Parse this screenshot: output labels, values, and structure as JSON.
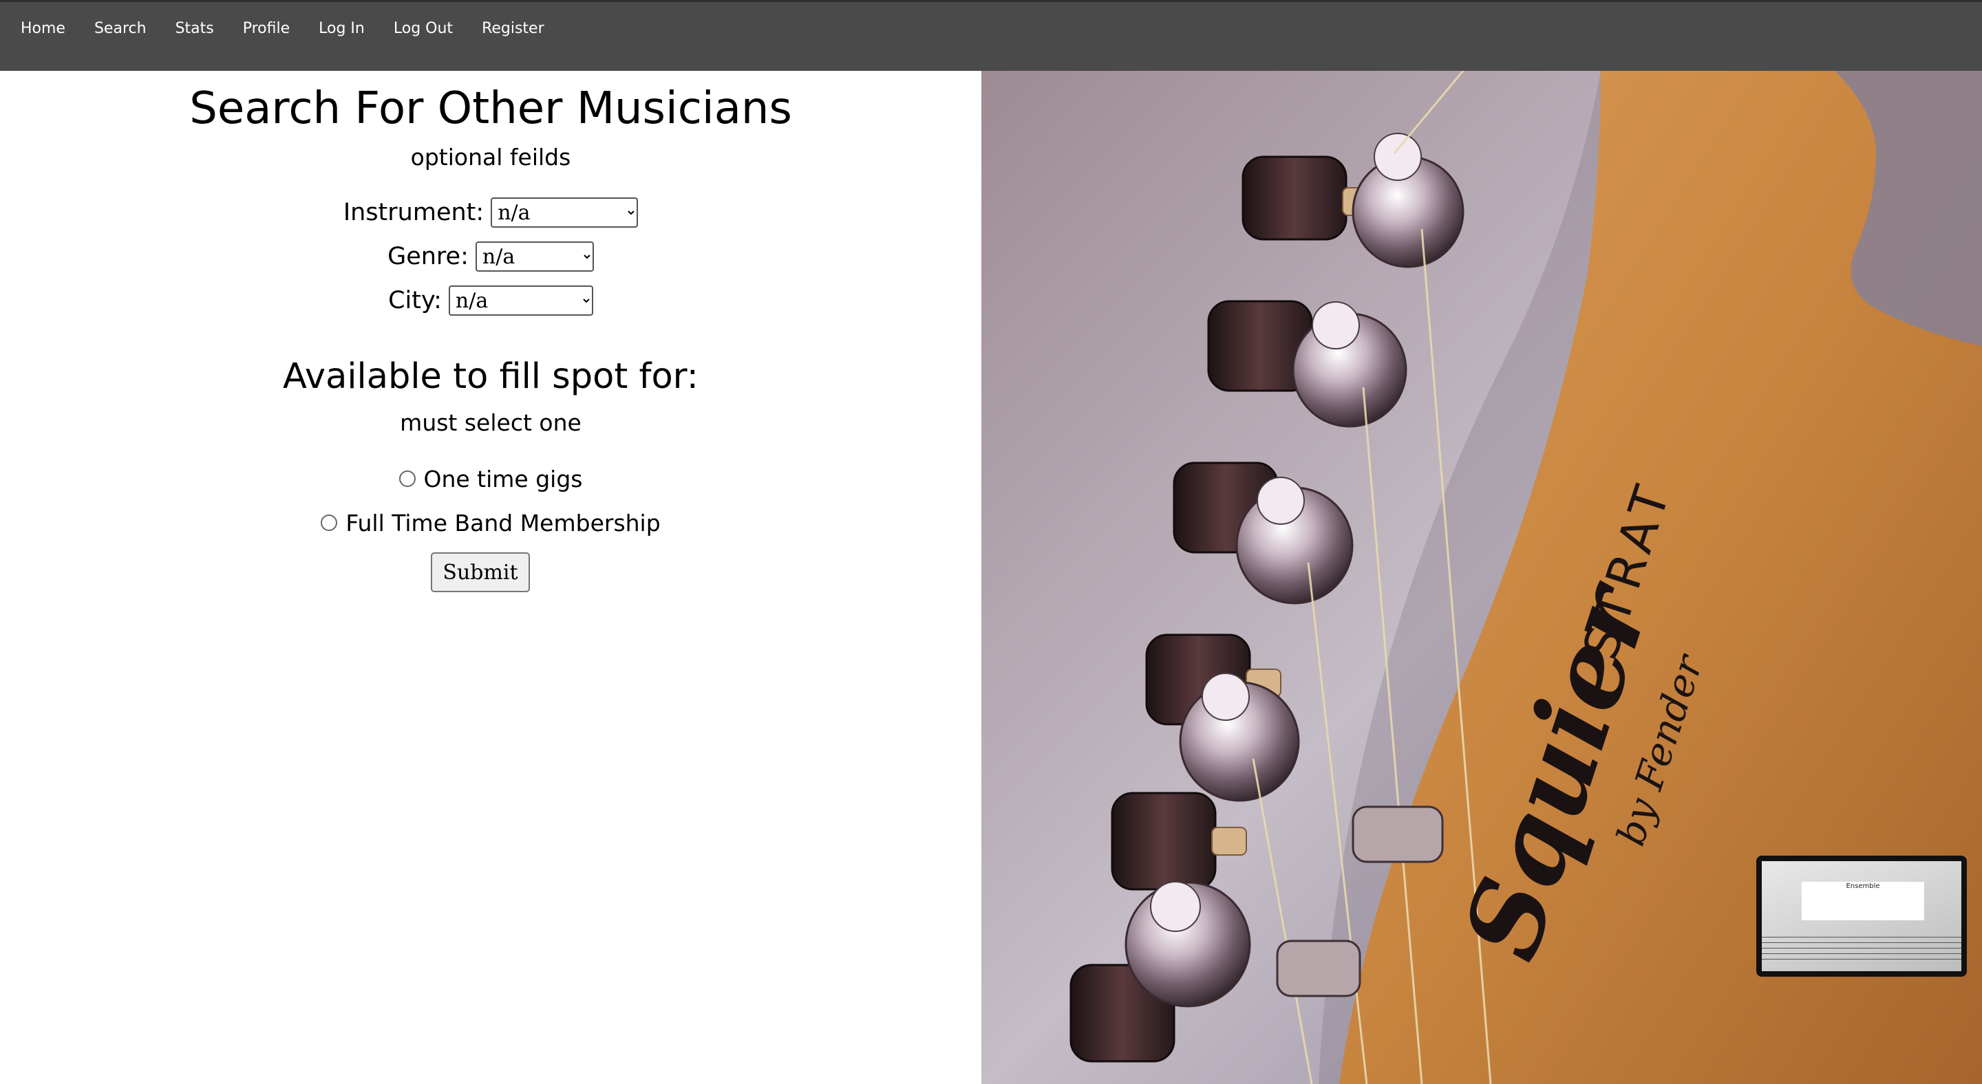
{
  "nav": {
    "items": [
      {
        "label": "Home"
      },
      {
        "label": "Search"
      },
      {
        "label": "Stats"
      },
      {
        "label": "Profile"
      },
      {
        "label": "Log In"
      },
      {
        "label": "Log Out"
      },
      {
        "label": "Register"
      }
    ]
  },
  "form": {
    "title": "Search For Other Musicians",
    "optional_note": "optional feilds",
    "instrument": {
      "label": "Instrument:",
      "value": "n/a"
    },
    "genre": {
      "label": "Genre:",
      "value": "n/a"
    },
    "city": {
      "label": "City:",
      "value": "n/a"
    },
    "availability_heading": "Available to fill spot for:",
    "required_note": "must select one",
    "options": [
      {
        "label": "One time gigs",
        "selected": false
      },
      {
        "label": "Full Time Band Membership",
        "selected": false
      }
    ],
    "submit_label": "Submit"
  },
  "hero": {
    "image": "fender squier stratocaster headstock photo",
    "headstock_text_1": "Squier",
    "headstock_text_2": "STRAT",
    "headstock_text_3": "by Fender"
  },
  "thumbnail": {
    "title": "Ensemble"
  },
  "colors": {
    "navbar": "#4a4a4a",
    "nav_text": "#ffffff",
    "page_bg": "#ffffff",
    "wood": "#c98a4a"
  }
}
